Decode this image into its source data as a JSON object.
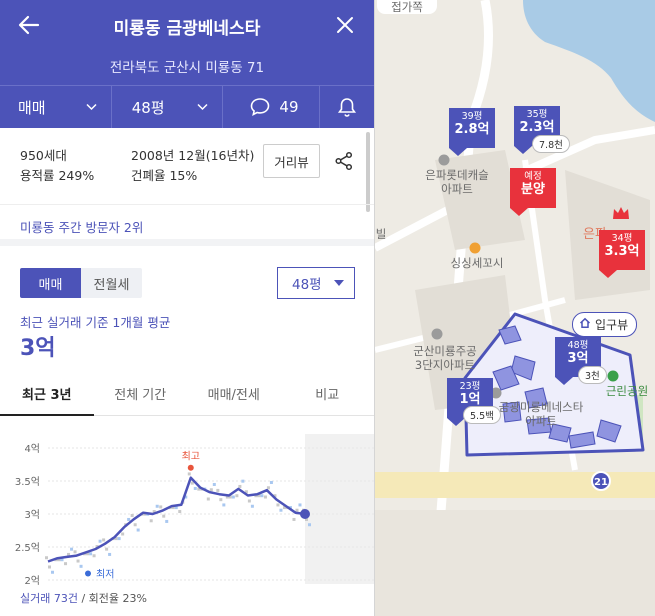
{
  "header": {
    "title": "미룡동 금광베네스타",
    "address": "전라북도 군산시 미룡동 71",
    "deal_type": "매매",
    "size": "48평",
    "comment_count": "49"
  },
  "info": {
    "households": "950세대",
    "built": "2008년 12월(16년차)",
    "far": "용적률 249%",
    "bcr": "건폐율 15%",
    "distance_button": "거리뷰"
  },
  "visitors": "미룡동 주간 방문자 2위",
  "toggle": {
    "on": "매매",
    "off": "전월세"
  },
  "size_select": "48평",
  "recent": {
    "label": "최근 실거래 기준 1개월 평균",
    "value": "3억"
  },
  "tabs": [
    "최근 3년",
    "전체 기간",
    "매매/전세",
    "비교"
  ],
  "chart_data": {
    "type": "line",
    "yticks": [
      "4억",
      "3.5억",
      "3억",
      "2.5억",
      "2억"
    ],
    "ylim": [
      2,
      4
    ],
    "series": [
      {
        "values": [
          2.28,
          2.33,
          2.35,
          2.37,
          2.42,
          2.47,
          2.55,
          2.65,
          2.8,
          2.92,
          3.02,
          3.0,
          3.05,
          3.12,
          3.14,
          3.55,
          3.4,
          3.33,
          3.3,
          3.28,
          3.38,
          3.28,
          3.3,
          3.36,
          3.22,
          3.12,
          3.02,
          3.0
        ]
      }
    ],
    "high_label": "최고",
    "low_label": "최저",
    "high": 3.58,
    "low": 2.25,
    "color": "#4c53b8"
  },
  "footer": {
    "count": "실거래 73건",
    "turnover": "/ 회전율 23%"
  },
  "map": {
    "markers": [
      {
        "size": "39평",
        "price": "2.8억",
        "color": "blue"
      },
      {
        "size": "35평",
        "price": "2.3억",
        "color": "blue",
        "pill": "7.8천"
      },
      {
        "size": "예정",
        "price": "분양",
        "color": "red"
      },
      {
        "size": "34평",
        "price": "3.3억",
        "color": "red"
      },
      {
        "size": "48평",
        "price": "3억",
        "color": "blue",
        "pill": "3천"
      },
      {
        "size": "23평",
        "price": "1억",
        "color": "blue",
        "pill": "5.5백"
      }
    ],
    "labels": {
      "apt1a": "은파롯데캐슬",
      "apt1b": "아파트",
      "eunpa": "은파",
      "cafe": "싱싱세꼬시",
      "apt2a": "군산미룡주공",
      "apt2b": "3단지아파트",
      "apt3a": "금광미룡베네스타",
      "apt3b": "아파트",
      "park": "근린공원",
      "villa": "빌",
      "top": "접가쪽",
      "route": "21"
    },
    "entrance": "입구뷰"
  }
}
